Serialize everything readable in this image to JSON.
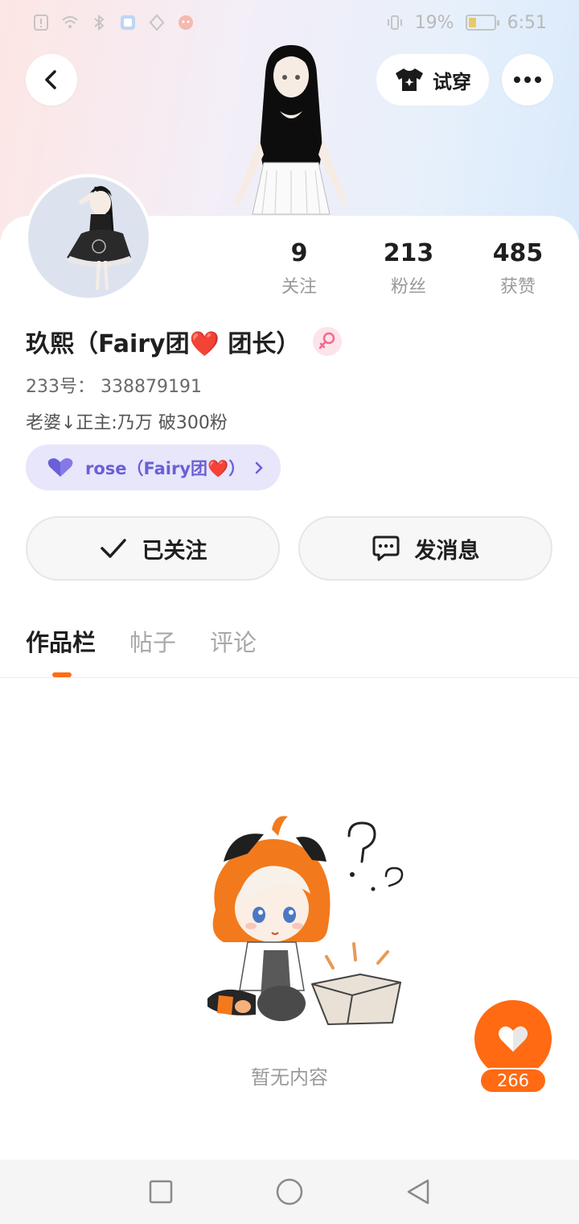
{
  "status_bar": {
    "battery_percent": "19%",
    "time": "6:51"
  },
  "header": {
    "try_on_label": "试穿"
  },
  "profile": {
    "stats": [
      {
        "value": "9",
        "label": "关注"
      },
      {
        "value": "213",
        "label": "粉丝"
      },
      {
        "value": "485",
        "label": "获赞"
      }
    ],
    "name": "玖熙（Fairy团❤️ 团长）",
    "uid": "233号：  338879191",
    "bio": "老婆↓正主:乃万  破300粉",
    "group_chip": "rose（Fairy团❤️）",
    "follow_label": "已关注",
    "message_label": "发消息"
  },
  "tabs": [
    {
      "label": "作品栏",
      "active": true
    },
    {
      "label": "帖子",
      "active": false
    },
    {
      "label": "评论",
      "active": false
    }
  ],
  "empty_state": {
    "text": "暂无内容"
  },
  "like_fab": {
    "count": "266"
  },
  "colors": {
    "accent": "#ff6a13",
    "chip_bg": "#e7e6fb",
    "chip_text": "#6a5fd6"
  }
}
